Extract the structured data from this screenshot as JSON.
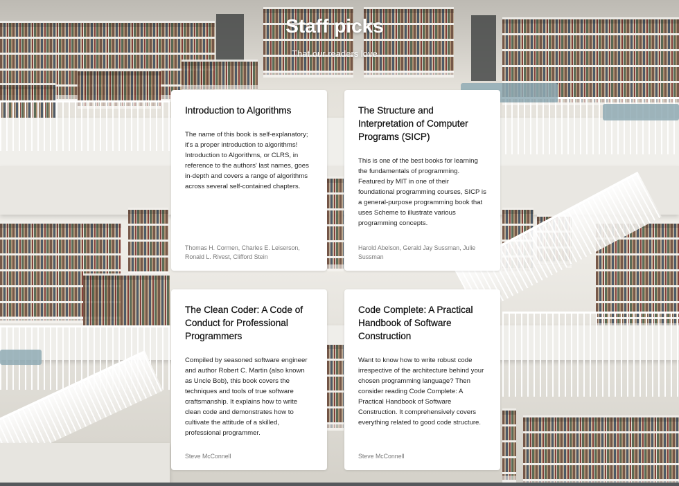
{
  "header": {
    "title": "Staff picks",
    "subtitle": "That our readers love"
  },
  "books": [
    {
      "title": "Introduction to Algorithms",
      "description": "The name of this book is self-explanatory; it's a proper introduction to algorithms! Introduction to Algorithms, or CLRS, in reference to the authors' last names, goes in-depth and covers a range of algorithms across several self-contained chapters.",
      "authors": "Thomas H. Cormen, Charles E. Leiserson, Ronald L. Rivest, Clifford Stein"
    },
    {
      "title": "The Structure and Interpretation of Computer Programs (SICP)",
      "description": "This is one of the best books for learning the fundamentals of programming. Featured by MIT in one of their foundational programming courses, SICP is a general-purpose programming book that uses Scheme to illustrate various programming concepts.",
      "authors": "Harold Abelson, Gerald Jay Sussman, Julie Sussman"
    },
    {
      "title": "The Clean Coder: A Code of Conduct for Professional Programmers",
      "description": "Compiled by seasoned software engineer and author Robert C. Martin (also known as Uncle Bob), this book covers the techniques and tools of true software craftsmanship. It explains how to write clean code and demonstrates how to cultivate the attitude of a skilled, professional programmer.",
      "authors": "Steve McConnell"
    },
    {
      "title": "Code Complete: A Practical Handbook of Software Construction",
      "description": "Want to know how to write robust code irrespective of the architecture behind your chosen programming language? Then consider reading Code Complete: A Practical Handbook of Software Construction. It comprehensively covers everything related to good code structure.",
      "authors": "Steve McConnell"
    }
  ]
}
